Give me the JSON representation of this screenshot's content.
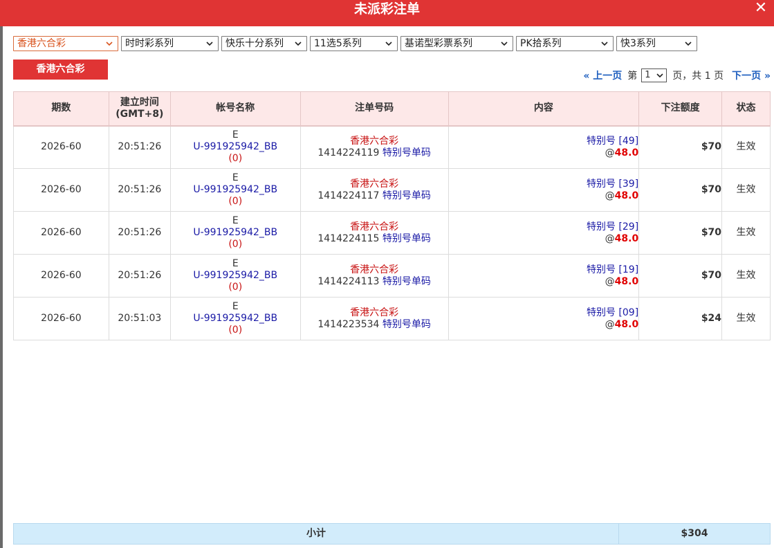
{
  "title": "未派彩注单",
  "close_icon": "close-icon",
  "filters": [
    {
      "label": "香港六合彩",
      "active": true
    },
    {
      "label": "时时彩系列",
      "active": false
    },
    {
      "label": "快乐十分系列",
      "active": false
    },
    {
      "label": "11选5系列",
      "active": false
    },
    {
      "label": "基诺型彩票系列",
      "active": false
    },
    {
      "label": "PK拾系列",
      "active": false
    },
    {
      "label": "快3系列",
      "active": false
    }
  ],
  "lottery_tab": "香港六合彩",
  "pager": {
    "prev": "« 上一页",
    "page_prefix": "第",
    "current_page": "1",
    "total": "页，共 1 页",
    "next": "下一页 »"
  },
  "table": {
    "headers": [
      "期数",
      "建立时间\n(GMT+8)",
      "帐号名称",
      "注单号码",
      "内容",
      "下注额度",
      "状态"
    ],
    "rows": [
      {
        "period": "2026-60",
        "time": "20:51:26",
        "acct_prefix": "E",
        "account": "U-991925942_BB",
        "acct_count": "(0)",
        "lottery": "香港六合彩",
        "bet_no": "1414224119",
        "bet_type": "特别号单码",
        "content_label": "特别号 [49]",
        "odds_prefix": "@",
        "odds": "48.0",
        "amount": "$70",
        "status": "生效"
      },
      {
        "period": "2026-60",
        "time": "20:51:26",
        "acct_prefix": "E",
        "account": "U-991925942_BB",
        "acct_count": "(0)",
        "lottery": "香港六合彩",
        "bet_no": "1414224117",
        "bet_type": "特别号单码",
        "content_label": "特别号 [39]",
        "odds_prefix": "@",
        "odds": "48.0",
        "amount": "$70",
        "status": "生效"
      },
      {
        "period": "2026-60",
        "time": "20:51:26",
        "acct_prefix": "E",
        "account": "U-991925942_BB",
        "acct_count": "(0)",
        "lottery": "香港六合彩",
        "bet_no": "1414224115",
        "bet_type": "特别号单码",
        "content_label": "特别号 [29]",
        "odds_prefix": "@",
        "odds": "48.0",
        "amount": "$70",
        "status": "生效"
      },
      {
        "period": "2026-60",
        "time": "20:51:26",
        "acct_prefix": "E",
        "account": "U-991925942_BB",
        "acct_count": "(0)",
        "lottery": "香港六合彩",
        "bet_no": "1414224113",
        "bet_type": "特别号单码",
        "content_label": "特别号 [19]",
        "odds_prefix": "@",
        "odds": "48.0",
        "amount": "$70",
        "status": "生效"
      },
      {
        "period": "2026-60",
        "time": "20:51:03",
        "acct_prefix": "E",
        "account": "U-991925942_BB",
        "acct_count": "(0)",
        "lottery": "香港六合彩",
        "bet_no": "1414223534",
        "bet_type": "特别号单码",
        "content_label": "特别号 [09]",
        "odds_prefix": "@",
        "odds": "48.0",
        "amount": "$24",
        "status": "生效"
      }
    ]
  },
  "subtotal": {
    "label": "小计",
    "value": "$304"
  },
  "colors": {
    "brand_red": "#e03434",
    "header_bg": "#fde8e8",
    "subtotal_bg": "#d2ecfb",
    "link_blue": "#1a1aa6",
    "odds_red": "#e00000"
  }
}
